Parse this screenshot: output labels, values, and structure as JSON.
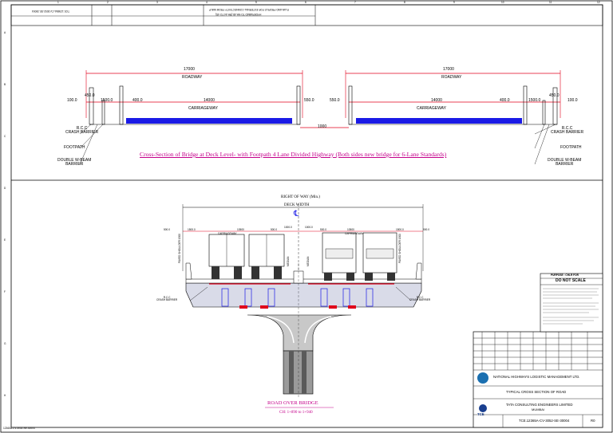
{
  "header": {
    "project_title": "FLAN AND PROFILE FOR EXTERNAL CONNECTIVITY FROM NMLP",
    "project_subtitle": "HYDERABAD TO NH-48 (RH-44 TO 4S)",
    "doc_no": "TCE.12365A-CV-3052-SE-30004"
  },
  "deck_section": {
    "left": {
      "total_width": "17000",
      "roadway": "ROADWAY",
      "carriageway_width": "14000",
      "carriageway": "CARRIAGEWAY",
      "dims": [
        "100.0",
        "450.0",
        "1500.0",
        "400.0",
        "550.0"
      ]
    },
    "right": {
      "total_width": "17000",
      "roadway": "ROADWAY",
      "carriageway_width": "14000",
      "carriageway": "CARRIAGEWAY",
      "dims": [
        "550.0",
        "400.0",
        "1500.0",
        "450.0",
        "100.0"
      ]
    },
    "median_gap": "1000",
    "labels": {
      "rcc_crash_barrier": "R.C.C\nCRASH BARRIER",
      "footpath": "FOOTPATH",
      "double_wbeam": "DOUBLE W-BEAM\nBARRIER"
    },
    "caption": "Cross-Section of Bridge at Deck Level- with Footpath 4 Lane Divided Highway (Both sides new bridge for 6-Lane Standards)"
  },
  "rob_section": {
    "right_of_way": "RIGHT OF WAY (Min.)",
    "deck_width": "DECK WIDTH",
    "centerline": "℄",
    "carriageway_left": "CARRIAGEWAY",
    "carriageway_right": "CARRIAGEWAY",
    "dim_left": [
      "500.0",
      "1500.0",
      "10500",
      "500.0",
      "1000.0"
    ],
    "dim_right": [
      "1000.0",
      "500.0",
      "10500",
      "1500.0",
      "500.0"
    ],
    "paved_shoulder_left": "PAVED SHOULDER 1500",
    "paved_shoulder_right": "PAVED SHOULDER 1500",
    "median_left": "MEDIAN",
    "median_right": "MEDIAN",
    "rcc_left": "R.C.C\nCRASH BARRIER",
    "rcc_right": "R.C.C\nCRASH BARRIER",
    "title": "ROAD OVER BRIDGE",
    "chainage": "CH: 1+890 to 1+940"
  },
  "notes": {
    "heading": "PURPOSE : CHLR FOR",
    "do_not_scale": "DO NOT SCALE"
  },
  "title_block": {
    "client": "NATIONAL HIGHWAYS LOGISTIC MANAGEMENT LTD.",
    "drawing_title": "TYPICAL CROSS SECTION OF ROAD",
    "consultant_line1": "TATA CONSULTING ENGINEERS LIMITED",
    "consultant_line2": "MUMBAI",
    "drawing_no": "TCE.12365A-CV-3052-SE-30004",
    "revision": "R0",
    "tce_logo": "TCE"
  },
  "footer": {
    "file_ref": "12365A-CV-3052-SE-30004"
  },
  "grid": {
    "cols": [
      "1",
      "2",
      "3",
      "4",
      "5",
      "6",
      "7",
      "8",
      "9",
      "10",
      "11",
      "12"
    ],
    "rows": [
      "A",
      "B",
      "C",
      "D",
      "E",
      "F",
      "G",
      "H"
    ]
  },
  "colors": {
    "red": "#e0001b",
    "blue": "#1a1ae6",
    "magenta": "#c4008a",
    "gray": "#9a9a9a"
  }
}
